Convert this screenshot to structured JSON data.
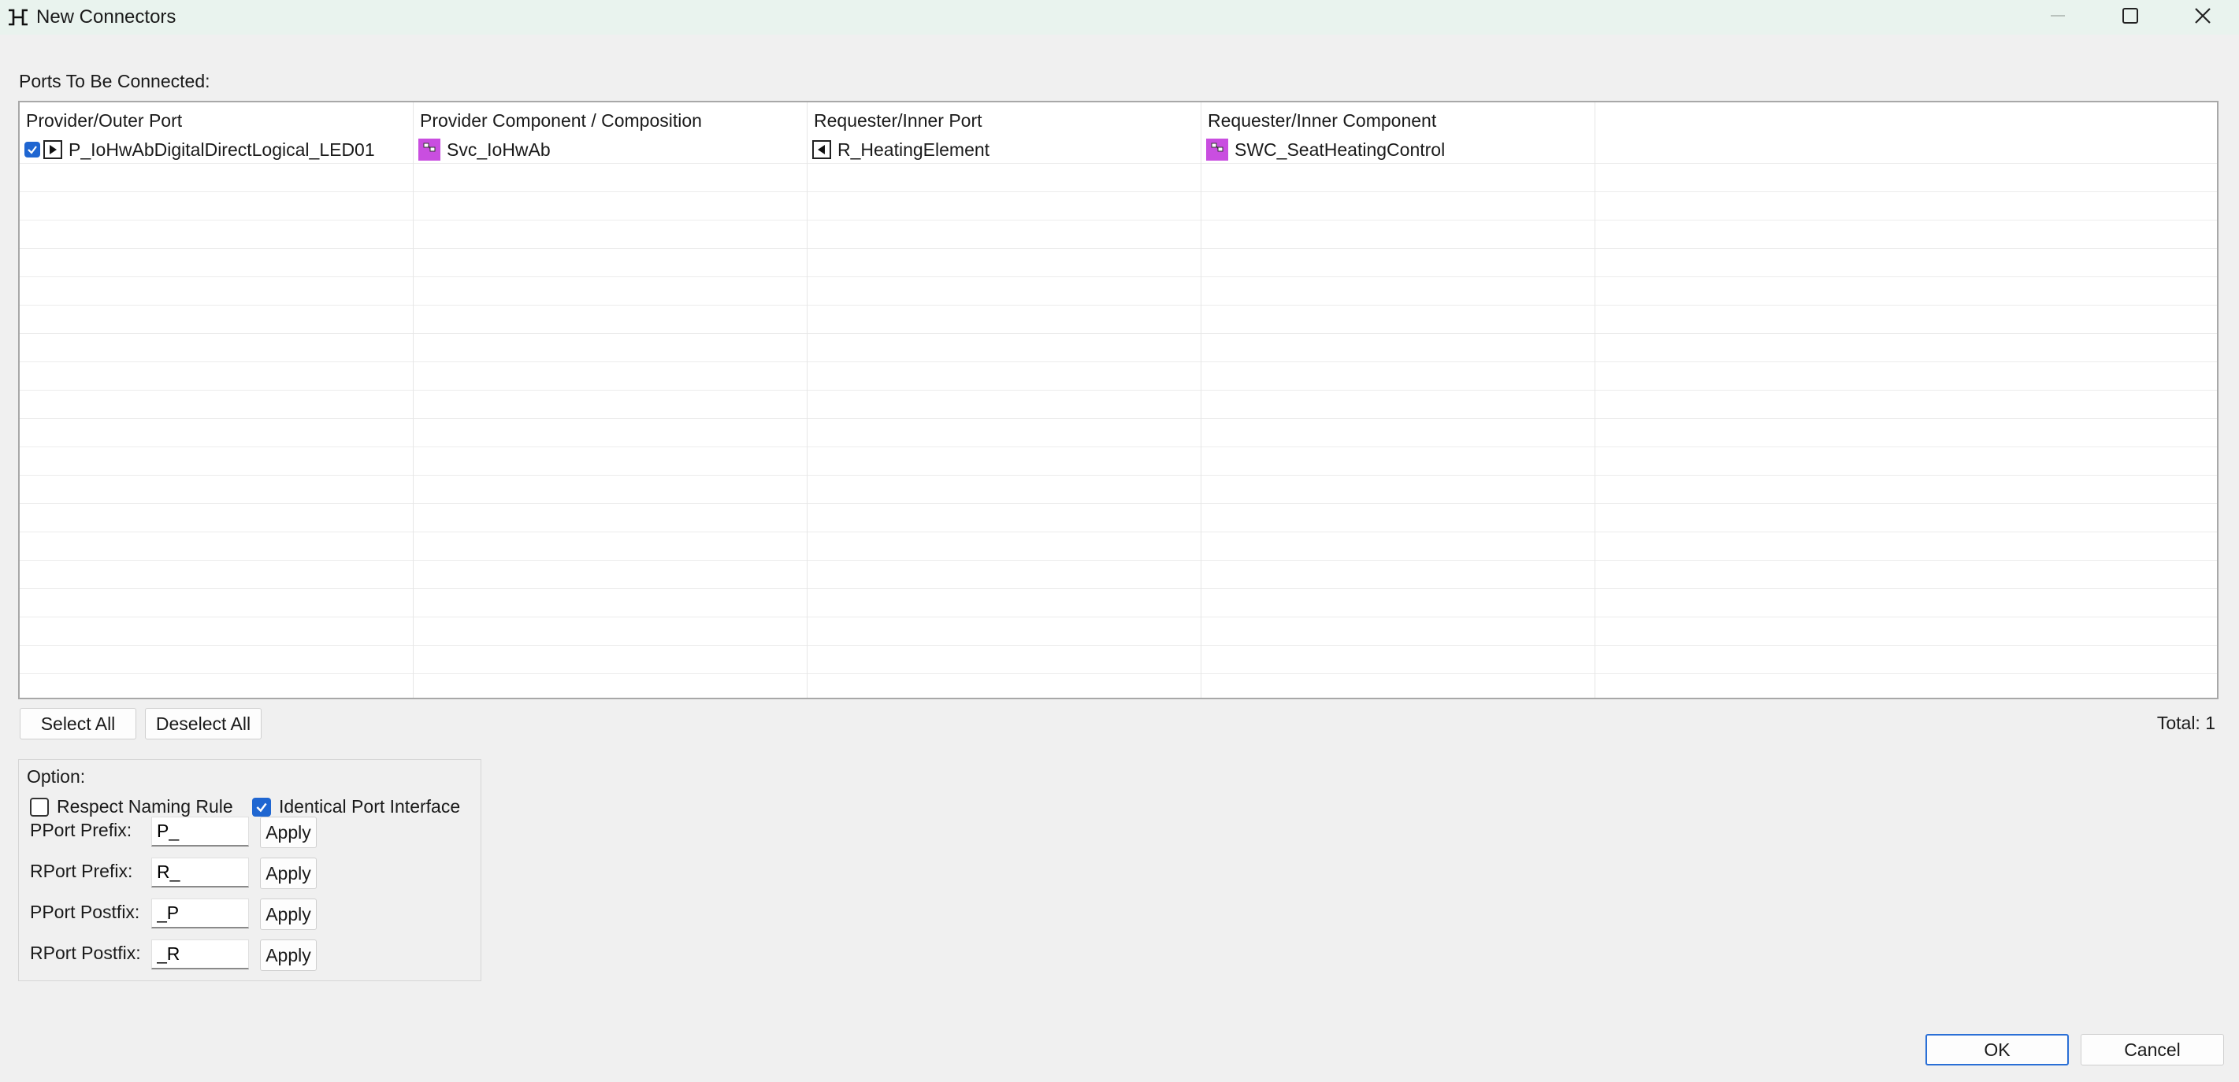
{
  "window": {
    "title": "New Connectors",
    "icons": {
      "app": "connector-icon",
      "minimize": "minimize-icon",
      "maximize": "maximize-icon",
      "close": "close-icon"
    }
  },
  "section_label": "Ports To Be Connected:",
  "table": {
    "columns": [
      "Provider/Outer Port",
      "Provider Component / Composition",
      "Requester/Inner Port",
      "Requester/Inner Component",
      ""
    ],
    "rows": [
      {
        "checked": true,
        "provider_port": "P_IoHwAbDigitalDirectLogical_LED01",
        "provider_port_icon": "provider-port-icon",
        "provider_component": "Svc_IoHwAb",
        "provider_component_icon": "component-icon",
        "requester_port": "R_HeatingElement",
        "requester_port_icon": "requester-port-icon",
        "requester_component": "SWC_SeatHeatingControl",
        "requester_component_icon": "component-icon"
      }
    ]
  },
  "buttons": {
    "select_all": "Select All",
    "deselect_all": "Deselect All",
    "ok": "OK",
    "cancel": "Cancel"
  },
  "total": "Total: 1",
  "options": {
    "title": "Option:",
    "respect_naming_rule": {
      "label": "Respect Naming Rule",
      "checked": false
    },
    "identical_port_interface": {
      "label": "Identical Port Interface",
      "checked": true
    },
    "fields": [
      {
        "label": "PPort Prefix:",
        "value": "P_",
        "apply": "Apply"
      },
      {
        "label": "RPort Prefix:",
        "value": "R_",
        "apply": "Apply"
      },
      {
        "label": "PPort Postfix:",
        "value": "_P",
        "apply": "Apply"
      },
      {
        "label": "RPort Postfix:",
        "value": "_R",
        "apply": "Apply"
      }
    ]
  },
  "colors": {
    "titlebar": "#e9f3ee",
    "background": "#f0f0f0",
    "checkbox_accent": "#1f66d1",
    "component_icon": "#c94ee0",
    "default_button_border": "#2a6fd6"
  }
}
